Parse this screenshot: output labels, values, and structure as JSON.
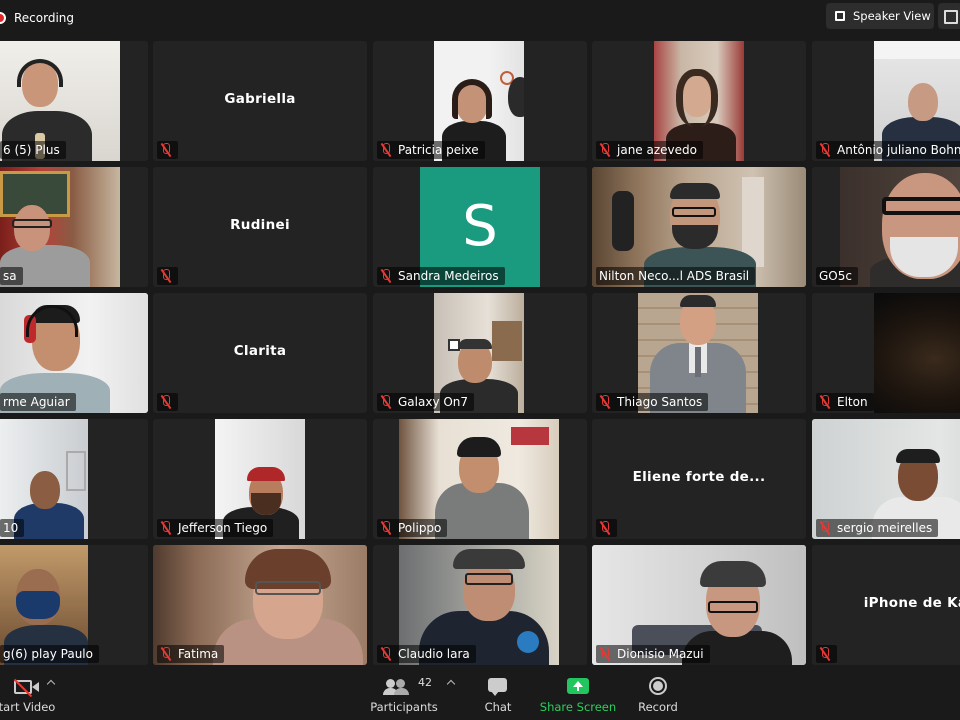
{
  "top": {
    "recording": "Recording",
    "speaker_view": "Speaker View"
  },
  "tiles": [
    {
      "label": "6 (5) Plus"
    },
    {
      "center": "Gabriella"
    },
    {
      "label": "Patricia peixe"
    },
    {
      "label": "jane azevedo"
    },
    {
      "label": "Antônio juliano Bohn"
    },
    {
      "label": "sa"
    },
    {
      "center": "Rudinei"
    },
    {
      "label": "Sandra Medeiros",
      "avatar": "S"
    },
    {
      "label": "Nilton Neco...l ADS Brasil"
    },
    {
      "label": "GO5c"
    },
    {
      "label": "rme Aguiar"
    },
    {
      "center": "Clarita"
    },
    {
      "label": "Galaxy On7"
    },
    {
      "label": "Thiago Santos"
    },
    {
      "label": "Elton"
    },
    {
      "label": "10"
    },
    {
      "label": "Jefferson Tiego"
    },
    {
      "label": "Polippo"
    },
    {
      "center": "Eliene forte de..."
    },
    {
      "label": "sergio meirelles"
    },
    {
      "label": "g(6) play Paulo"
    },
    {
      "label": "Fatima"
    },
    {
      "label": "Claudio lara"
    },
    {
      "label": "Dionisio Mazui"
    },
    {
      "center": "iPhone de Kar"
    }
  ],
  "toolbar": {
    "start_video": "tart Video",
    "participants": "Participants",
    "participants_count": "42",
    "chat": "Chat",
    "share_screen": "Share Screen",
    "record": "Record"
  }
}
